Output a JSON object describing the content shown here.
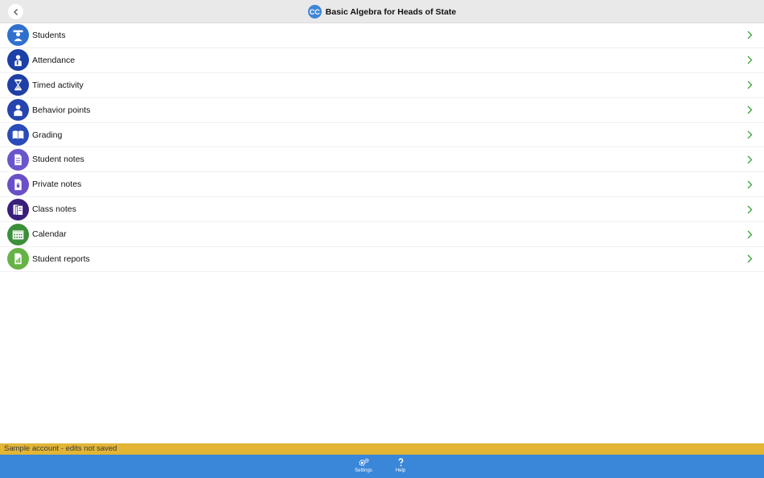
{
  "header": {
    "badge": "CC",
    "title": "Basic Algebra for Heads of State"
  },
  "menu": {
    "items": [
      {
        "label": "Students",
        "icon": "graduate-icon",
        "color": "#2f6fce"
      },
      {
        "label": "Attendance",
        "icon": "attendance-icon",
        "color": "#1d3fa8"
      },
      {
        "label": "Timed activity",
        "icon": "hourglass-icon",
        "color": "#1f3fa6"
      },
      {
        "label": "Behavior points",
        "icon": "person-icon",
        "color": "#2544b0"
      },
      {
        "label": "Grading",
        "icon": "book-icon",
        "color": "#2a4bb8"
      },
      {
        "label": "Student notes",
        "icon": "note-icon",
        "color": "#6b55cc"
      },
      {
        "label": "Private notes",
        "icon": "lock-note-icon",
        "color": "#6a4fc8"
      },
      {
        "label": "Class notes",
        "icon": "notes-stack-icon",
        "color": "#3a1f7a"
      },
      {
        "label": "Calendar",
        "icon": "calendar-icon",
        "color": "#3c8f3a"
      },
      {
        "label": "Student reports",
        "icon": "report-icon",
        "color": "#66b246"
      }
    ]
  },
  "sample": {
    "text": "Sample account - edits not saved"
  },
  "tabs": {
    "settings": "Settings",
    "help": "Help"
  },
  "colors": {
    "accent": "#3a86d8",
    "chevron": "#3aa13a",
    "sample_bar": "#e2b535"
  }
}
